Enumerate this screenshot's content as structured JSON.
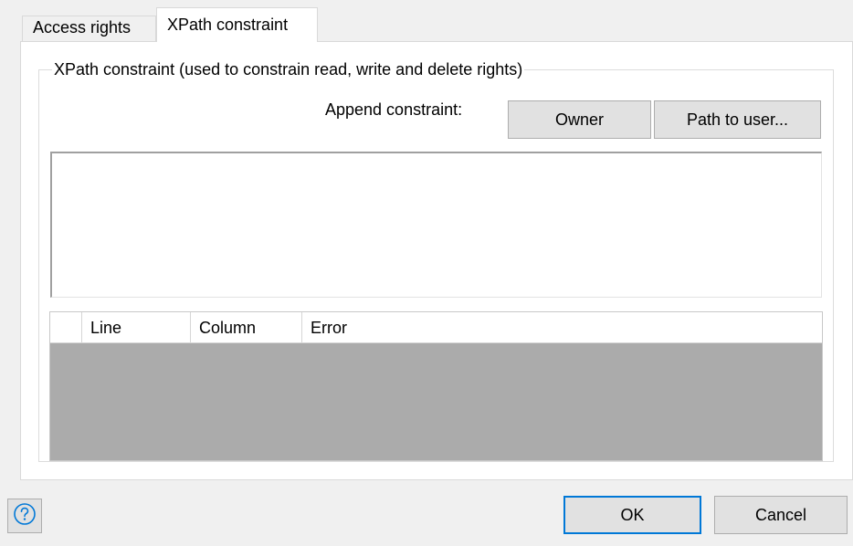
{
  "tabs": [
    {
      "label": "Access rights",
      "active": false
    },
    {
      "label": "XPath constraint",
      "active": true
    }
  ],
  "xpath": {
    "group_title": "XPath constraint (used to constrain read, write and delete rights)",
    "append_label": "Append constraint:",
    "owner_button": "Owner",
    "path_button": "Path to user...",
    "editor_value": ""
  },
  "error_grid": {
    "columns": [
      "",
      "Line",
      "Column",
      "Error"
    ],
    "rows": []
  },
  "footer": {
    "help_icon": "help-circle-icon",
    "ok_label": "OK",
    "cancel_label": "Cancel"
  },
  "colors": {
    "accent": "#0078d7",
    "background": "#f0f0f0",
    "button": "#e1e1e1",
    "grid_empty": "#ababab"
  }
}
